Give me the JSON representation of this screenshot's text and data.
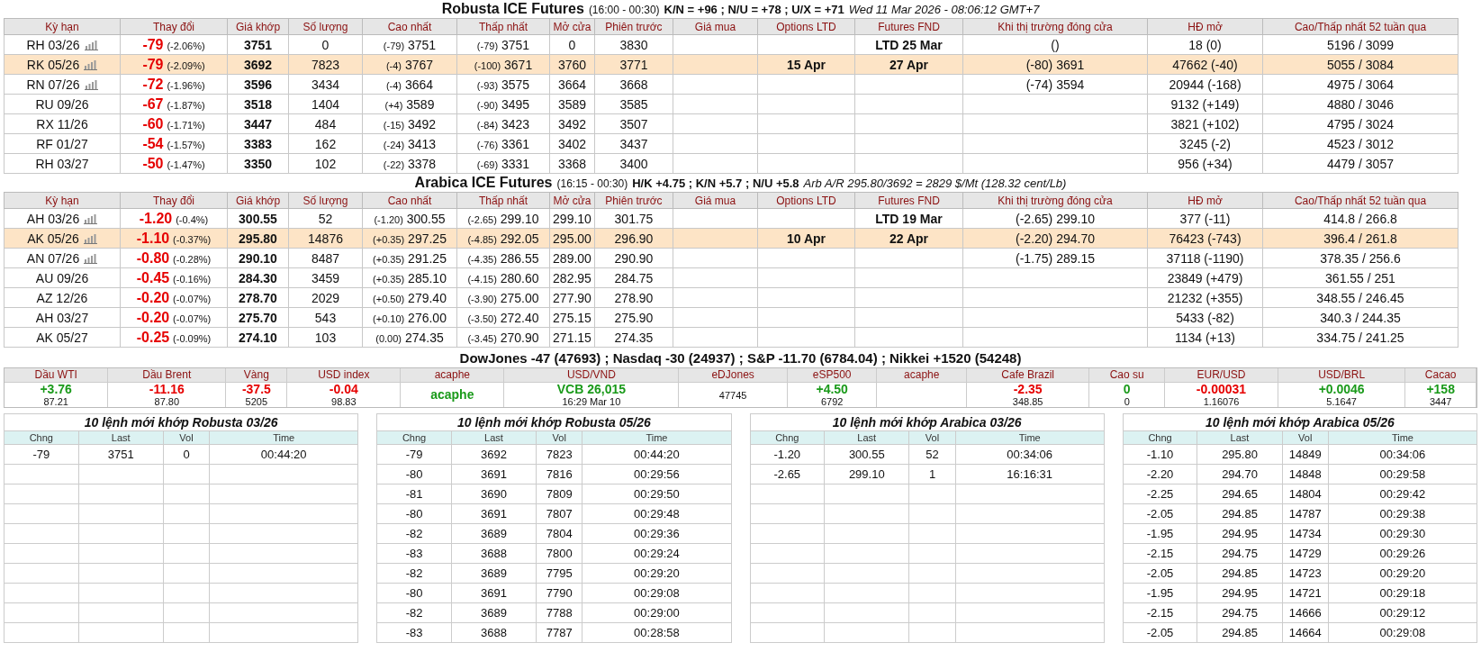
{
  "robusta": {
    "title": {
      "name": "Robusta ICE Futures",
      "hours": "(16:00 - 00:30)",
      "spreads": "K/N = +96 ; N/U = +78 ; U/X = +71",
      "note": "Wed 11 Mar 2026 - 08:06:12 GMT+7"
    },
    "columns": [
      "Kỳ hạn",
      "Thay đổi",
      "Giá khớp",
      "Số lượng",
      "Cao nhất",
      "Thấp nhất",
      "Mở cửa",
      "Phiên trước",
      "Giá mua",
      "Options LTD",
      "Futures FND",
      "Khi thị trường đóng cửa",
      "HĐ mở",
      "Cao/Thấp nhất 52 tuần qua"
    ],
    "rows": [
      {
        "contract": "RH 03/26",
        "chart_icon": true,
        "change": "-79",
        "pct": "(-2.06%)",
        "color": "#e60000",
        "price": "3751",
        "volume": "0",
        "high_chg": "(-79)",
        "high": "3751",
        "low_chg": "(-79)",
        "low": "3751",
        "open": "0",
        "prev": "3830",
        "futures_fnd": "LTD 25 Mar",
        "close": "()",
        "oi": "18 (0)",
        "range": "5196 / 3099",
        "selected": false
      },
      {
        "contract": "RK 05/26",
        "chart_icon": true,
        "change": "-79",
        "pct": "(-2.09%)",
        "color": "#e60000",
        "price": "3692",
        "volume": "7823",
        "high_chg": "(-4)",
        "high": "3767",
        "low_chg": "(-100)",
        "low": "3671",
        "open": "3760",
        "prev": "3771",
        "options_ltd": "15 Apr",
        "futures_fnd": "27 Apr",
        "close": "(-80) 3691",
        "oi": "47662 (-40)",
        "range": "5055 / 3084",
        "selected": true
      },
      {
        "contract": "RN 07/26",
        "chart_icon": true,
        "change": "-72",
        "pct": "(-1.96%)",
        "color": "#e60000",
        "price": "3596",
        "volume": "3434",
        "high_chg": "(-4)",
        "high": "3664",
        "low_chg": "(-93)",
        "low": "3575",
        "open": "3664",
        "prev": "3668",
        "close": "(-74) 3594",
        "oi": "20944 (-168)",
        "range": "4975 / 3064",
        "selected": false
      },
      {
        "contract": "RU 09/26",
        "chart_icon": false,
        "change": "-67",
        "pct": "(-1.87%)",
        "color": "#e60000",
        "price": "3518",
        "volume": "1404",
        "high_chg": "(+4)",
        "high": "3589",
        "low_chg": "(-90)",
        "low": "3495",
        "open": "3589",
        "prev": "3585",
        "oi": "9132 (+149)",
        "range": "4880 / 3046",
        "selected": false
      },
      {
        "contract": "RX 11/26",
        "chart_icon": false,
        "change": "-60",
        "pct": "(-1.71%)",
        "color": "#e60000",
        "price": "3447",
        "volume": "484",
        "high_chg": "(-15)",
        "high": "3492",
        "low_chg": "(-84)",
        "low": "3423",
        "open": "3492",
        "prev": "3507",
        "oi": "3821 (+102)",
        "range": "4795 / 3024",
        "selected": false
      },
      {
        "contract": "RF 01/27",
        "chart_icon": false,
        "change": "-54",
        "pct": "(-1.57%)",
        "color": "#e60000",
        "price": "3383",
        "volume": "162",
        "high_chg": "(-24)",
        "high": "3413",
        "low_chg": "(-76)",
        "low": "3361",
        "open": "3402",
        "prev": "3437",
        "oi": "3245 (-2)",
        "range": "4523 / 3012",
        "selected": false
      },
      {
        "contract": "RH 03/27",
        "chart_icon": false,
        "change": "-50",
        "pct": "(-1.47%)",
        "color": "#e60000",
        "price": "3350",
        "volume": "102",
        "high_chg": "(-22)",
        "high": "3378",
        "low_chg": "(-69)",
        "low": "3331",
        "open": "3368",
        "prev": "3400",
        "oi": "956 (+34)",
        "range": "4479 / 3057",
        "selected": false
      }
    ]
  },
  "arabica": {
    "title": {
      "name": "Arabica ICE Futures",
      "hours": "(16:15 - 00:30)",
      "spreads": "H/K +4.75 ; K/N +5.7 ; N/U +5.8",
      "note": "Arb A/R 295.80/3692 = 2829 $/Mt (128.32 cent/Lb)"
    },
    "columns": [
      "Kỳ hạn",
      "Thay đổi",
      "Giá khớp",
      "Số lượng",
      "Cao nhất",
      "Thấp nhất",
      "Mở cửa",
      "Phiên trước",
      "Giá mua",
      "Options LTD",
      "Futures FND",
      "Khi thị trường đóng cửa",
      "HĐ mở",
      "Cao/Thấp nhất 52 tuần qua"
    ],
    "rows": [
      {
        "contract": "AH 03/26",
        "chart_icon": true,
        "change": "-1.20",
        "pct": "(-0.4%)",
        "color": "#e60000",
        "price": "300.55",
        "volume": "52",
        "high_chg": "(-1.20)",
        "high": "300.55",
        "low_chg": "(-2.65)",
        "low": "299.10",
        "open": "299.10",
        "prev": "301.75",
        "futures_fnd": "LTD 19 Mar",
        "close": "(-2.65) 299.10",
        "oi": "377 (-11)",
        "range": "414.8 / 266.8",
        "selected": false
      },
      {
        "contract": "AK 05/26",
        "chart_icon": true,
        "change": "-1.10",
        "pct": "(-0.37%)",
        "color": "#e60000",
        "price": "295.80",
        "volume": "14876",
        "high_chg": "(+0.35)",
        "high": "297.25",
        "low_chg": "(-4.85)",
        "low": "292.05",
        "open": "295.00",
        "prev": "296.90",
        "options_ltd": "10 Apr",
        "futures_fnd": "22 Apr",
        "close": "(-2.20) 294.70",
        "oi": "76423 (-743)",
        "range": "396.4 / 261.8",
        "selected": true
      },
      {
        "contract": "AN 07/26",
        "chart_icon": true,
        "change": "-0.80",
        "pct": "(-0.28%)",
        "color": "#e60000",
        "price": "290.10",
        "volume": "8487",
        "high_chg": "(+0.35)",
        "high": "291.25",
        "low_chg": "(-4.35)",
        "low": "286.55",
        "open": "289.00",
        "prev": "290.90",
        "close": "(-1.75) 289.15",
        "oi": "37118 (-1190)",
        "range": "378.35 / 256.6",
        "selected": false
      },
      {
        "contract": "AU 09/26",
        "chart_icon": false,
        "change": "-0.45",
        "pct": "(-0.16%)",
        "color": "#e60000",
        "price": "284.30",
        "volume": "3459",
        "high_chg": "(+0.35)",
        "high": "285.10",
        "low_chg": "(-4.15)",
        "low": "280.60",
        "open": "282.95",
        "prev": "284.75",
        "oi": "23849 (+479)",
        "range": "361.55 / 251",
        "selected": false
      },
      {
        "contract": "AZ 12/26",
        "chart_icon": false,
        "change": "-0.20",
        "pct": "(-0.07%)",
        "color": "#e60000",
        "price": "278.70",
        "volume": "2029",
        "high_chg": "(+0.50)",
        "high": "279.40",
        "low_chg": "(-3.90)",
        "low": "275.00",
        "open": "277.90",
        "prev": "278.90",
        "oi": "21232 (+355)",
        "range": "348.55 / 246.45",
        "selected": false
      },
      {
        "contract": "AH 03/27",
        "chart_icon": false,
        "change": "-0.20",
        "pct": "(-0.07%)",
        "color": "#e60000",
        "price": "275.70",
        "volume": "543",
        "high_chg": "(+0.10)",
        "high": "276.00",
        "low_chg": "(-3.50)",
        "low": "272.40",
        "open": "275.15",
        "prev": "275.90",
        "oi": "5433 (-82)",
        "range": "340.3 / 244.35",
        "selected": false
      },
      {
        "contract": "AK 05/27",
        "chart_icon": false,
        "change": "-0.25",
        "pct": "(-0.09%)",
        "color": "#e60000",
        "price": "274.10",
        "volume": "103",
        "high_chg": "(0.00)",
        "high": "274.35",
        "low_chg": "(-3.45)",
        "low": "270.90",
        "open": "271.15",
        "prev": "274.35",
        "oi": "1134 (+13)",
        "range": "334.75 / 241.25",
        "selected": false
      }
    ]
  },
  "indices": "DowJones -47 (47693) ; Nasdaq -30 (24937) ; S&P -11.70 (6784.04) ; Nikkei +1520 (54248)",
  "ticker": [
    {
      "label": "Dầu WTI",
      "value": "+3.76",
      "sub": "87.21",
      "color": "#1a9a1a"
    },
    {
      "label": "Dầu Brent",
      "value": "-11.16",
      "sub": "87.80",
      "color": "#e60000"
    },
    {
      "label": "Vàng",
      "value": "-37.5",
      "sub": "5205",
      "color": "#e60000"
    },
    {
      "label": "USD index",
      "value": "-0.04",
      "sub": "98.83",
      "color": "#e60000"
    },
    {
      "label": "acaphe",
      "value": "acaphe",
      "color": "#1a9a1a"
    },
    {
      "label": "USD/VND",
      "value": "VCB 26,015",
      "sub": "16:29 Mar 10",
      "color": "#1a9a1a"
    },
    {
      "label": "eDJones",
      "sub": "47745"
    },
    {
      "label": "eSP500",
      "value": "+4.50",
      "sub": "6792",
      "color": "#1a9a1a"
    },
    {
      "label": "acaphe"
    },
    {
      "label": "Cafe Brazil",
      "value": "-2.35",
      "sub": "348.85",
      "color": "#e60000"
    },
    {
      "label": "Cao su",
      "value": "0",
      "sub": "0",
      "color": "#1a9a1a"
    },
    {
      "label": "EUR/USD",
      "value": "-0.00031",
      "sub": "1.16076",
      "color": "#e60000"
    },
    {
      "label": "USD/BRL",
      "value": "+0.0046",
      "sub": "5.1647",
      "color": "#1a9a1a"
    },
    {
      "label": "Cacao",
      "value": "+158",
      "sub": "3447",
      "color": "#1a9a1a"
    }
  ],
  "trades": [
    {
      "title": "10 lệnh mới khớp Robusta 03/26",
      "columns": [
        "Chng",
        "Last",
        "Vol",
        "Time"
      ],
      "rows": [
        [
          "-79",
          "3751",
          "0",
          "00:44:20"
        ]
      ]
    },
    {
      "title": "10 lệnh mới khớp Robusta 05/26",
      "columns": [
        "Chng",
        "Last",
        "Vol",
        "Time"
      ],
      "rows": [
        [
          "-79",
          "3692",
          "7823",
          "00:44:20"
        ],
        [
          "-80",
          "3691",
          "7816",
          "00:29:56"
        ],
        [
          "-81",
          "3690",
          "7809",
          "00:29:50"
        ],
        [
          "-80",
          "3691",
          "7807",
          "00:29:48"
        ],
        [
          "-82",
          "3689",
          "7804",
          "00:29:36"
        ],
        [
          "-83",
          "3688",
          "7800",
          "00:29:24"
        ],
        [
          "-82",
          "3689",
          "7795",
          "00:29:20"
        ],
        [
          "-80",
          "3691",
          "7790",
          "00:29:08"
        ],
        [
          "-82",
          "3689",
          "7788",
          "00:29:00"
        ],
        [
          "-83",
          "3688",
          "7787",
          "00:28:58"
        ]
      ]
    },
    {
      "title": "10 lệnh mới khớp Arabica 03/26",
      "columns": [
        "Chng",
        "Last",
        "Vol",
        "Time"
      ],
      "rows": [
        [
          "-1.20",
          "300.55",
          "52",
          "00:34:06"
        ],
        [
          "-2.65",
          "299.10",
          "1",
          "16:16:31"
        ]
      ]
    },
    {
      "title": "10 lệnh mới khớp Arabica 05/26",
      "columns": [
        "Chng",
        "Last",
        "Vol",
        "Time"
      ],
      "rows": [
        [
          "-1.10",
          "295.80",
          "14849",
          "00:34:06"
        ],
        [
          "-2.20",
          "294.70",
          "14848",
          "00:29:58"
        ],
        [
          "-2.25",
          "294.65",
          "14804",
          "00:29:42"
        ],
        [
          "-2.05",
          "294.85",
          "14787",
          "00:29:38"
        ],
        [
          "-1.95",
          "294.95",
          "14734",
          "00:29:30"
        ],
        [
          "-2.15",
          "294.75",
          "14729",
          "00:29:26"
        ],
        [
          "-2.05",
          "294.85",
          "14723",
          "00:29:20"
        ],
        [
          "-1.95",
          "294.95",
          "14721",
          "00:29:18"
        ],
        [
          "-2.15",
          "294.75",
          "14666",
          "00:29:12"
        ],
        [
          "-2.05",
          "294.85",
          "14664",
          "00:29:08"
        ]
      ]
    }
  ]
}
